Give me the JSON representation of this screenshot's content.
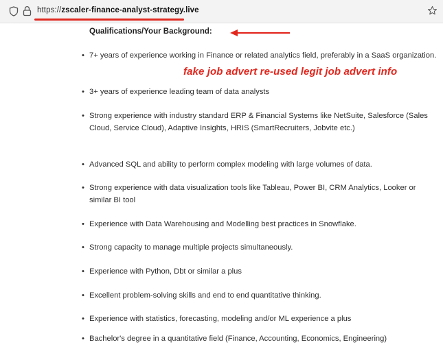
{
  "browser": {
    "url_scheme": "https://",
    "url_host": "zscaler-finance-analyst-strategy.live",
    "icons": [
      "shield-icon",
      "lock-icon",
      "star-icon"
    ]
  },
  "content": {
    "heading": "Qualifications/Your Background:",
    "annotation": "fake job advert re-used legit job advert info",
    "bullet_char": "•",
    "items": [
      {
        "text": "7+  years of experience working in Finance or related analytics field, preferably in a SaaS organization."
      },
      {
        "text": "3+ years of experience leading team of data analysts"
      },
      {
        "text": "Strong experience with industry standard ERP & Financial Systems like NetSuite, Salesforce (Sales Cloud, Service Cloud), Adaptive Insights, HRIS (SmartRecruiters, Jobvite etc.)"
      },
      {
        "text": "Advanced SQL and ability to perform complex modeling with large volumes of data."
      },
      {
        "text": "Strong experience with data visualization tools like Tableau, Power BI, CRM Analytics, Looker or similar BI tool"
      },
      {
        "text": "Experience with Data Warehousing and Modelling best practices in Snowflake."
      },
      {
        "text": "Strong capacity to manage multiple projects simultaneously."
      },
      {
        "text": "Experience with Python,  Dbt or similar a plus"
      },
      {
        "text": "Excellent problem-solving skills and end to end quantitative thinking."
      },
      {
        "text": "Experience with statistics, forecasting, modeling and/or ML experience a plus"
      },
      {
        "text": "Bachelor's degree in a quantitative field (Finance, Accounting, Economics, Engineering)"
      }
    ]
  },
  "colors": {
    "annotation_red": "#e2261d",
    "addressbar_bg": "#f3f3f4"
  }
}
